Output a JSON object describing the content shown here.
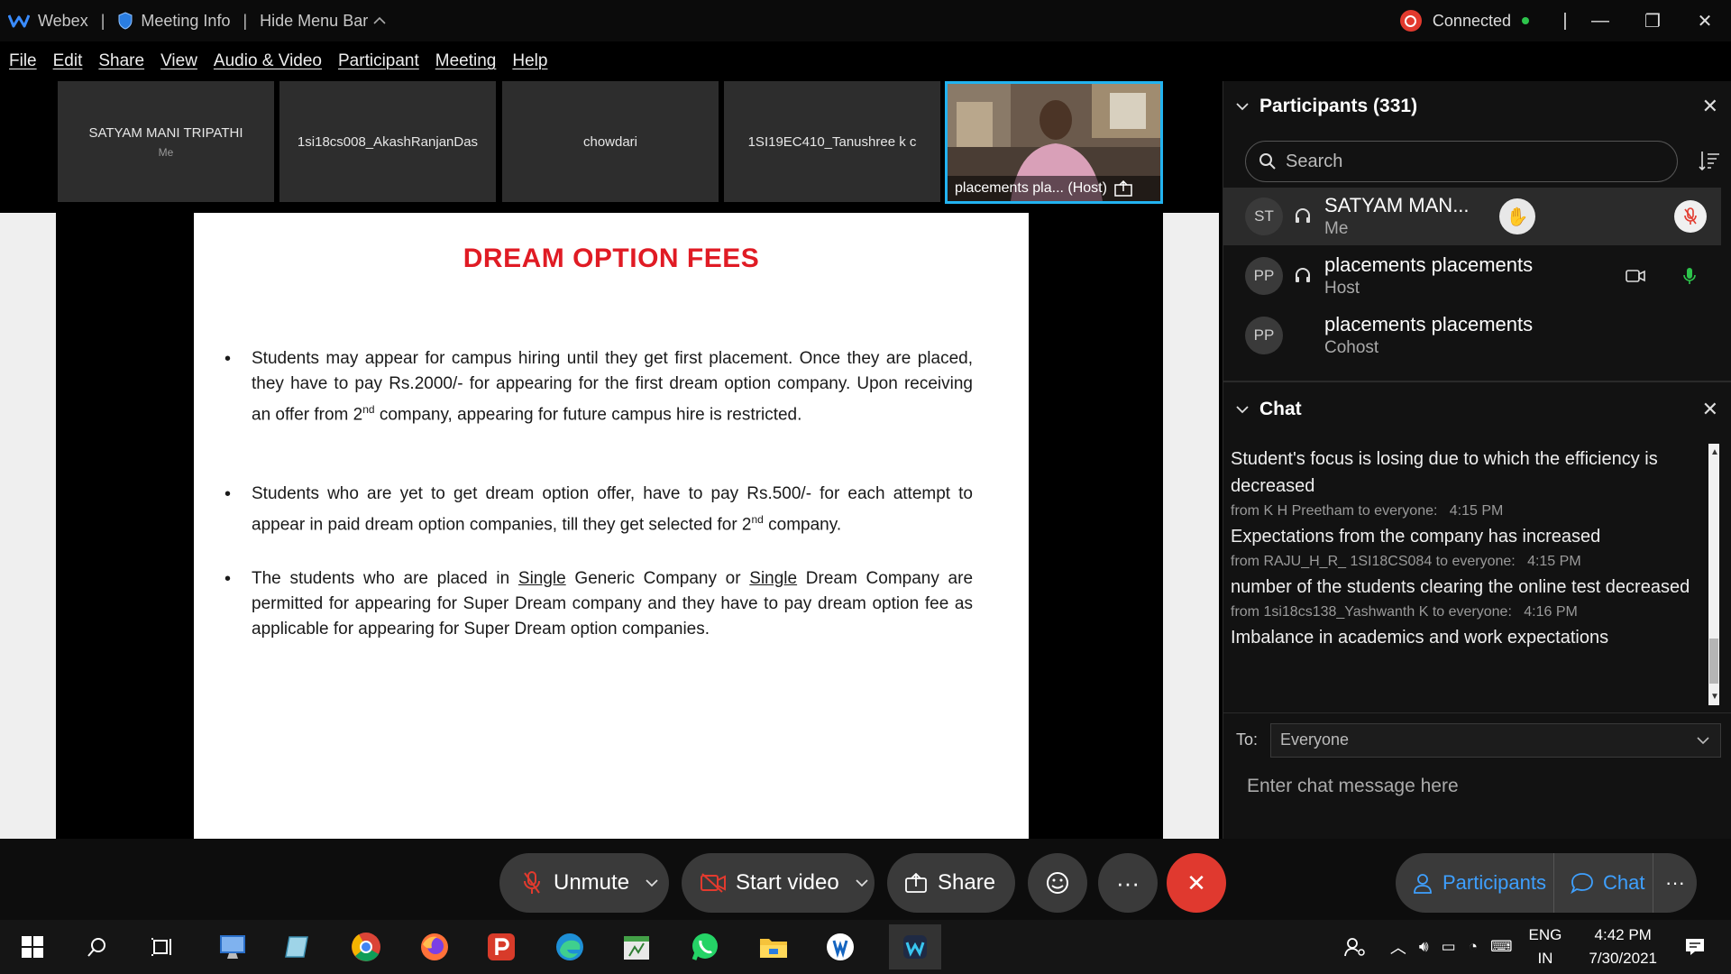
{
  "titlebar": {
    "app_name": "Webex",
    "meeting_info": "Meeting Info",
    "hide_menu": "Hide Menu Bar",
    "status": "Connected"
  },
  "menu": [
    "File",
    "Edit",
    "Share",
    "View",
    "Audio & Video",
    "Participant",
    "Meeting",
    "Help"
  ],
  "video_strip": {
    "tiles": [
      {
        "name": "SATYAM MANI TRIPATHI",
        "sub": "Me"
      },
      {
        "name": "1si18cs008_AkashRanjanDas",
        "sub": ""
      },
      {
        "name": "chowdari",
        "sub": ""
      },
      {
        "name": "1SI19EC410_Tanushree k c",
        "sub": ""
      }
    ],
    "host_tile": {
      "label": "placements pla... (Host)"
    }
  },
  "slide": {
    "title": "DREAM OPTION FEES",
    "bullet1_a": "Students may appear for campus hiring until they get first placement.  Once they are placed, they have to pay Rs.2000/- for appearing for the first dream option company. Upon receiving an offer from 2",
    "bullet1_sup": "nd",
    "bullet1_b": " company, appearing for future campus hire is restricted.",
    "bullet2_a": "Students who are yet to get dream option offer, have to pay Rs.500/- for each attempt to appear in paid dream option companies, till they get selected for 2",
    "bullet2_sup": "nd",
    "bullet2_b": " company.",
    "bullet3_a": "The students who are placed in ",
    "bullet3_u1": "Single",
    "bullet3_b": " Generic Company or ",
    "bullet3_u2": "Single",
    "bullet3_c": " Dream Company are permitted for appearing for Super Dream company and they have to pay dream option fee as applicable for appearing for Super Dream option companies."
  },
  "participants": {
    "header": "Participants (331)",
    "search_placeholder": "Search",
    "list": [
      {
        "initials": "ST",
        "name": "SATYAM MAN...",
        "role": "Me"
      },
      {
        "initials": "PP",
        "name": "placements placements",
        "role": "Host"
      },
      {
        "initials": "PP",
        "name": "placements placements",
        "role": "Cohost"
      }
    ]
  },
  "chat": {
    "header": "Chat",
    "messages": [
      {
        "text": "Student's focus is losing due to which the efficiency is decreased"
      },
      {
        "from": "from K H Preetham to everyone:",
        "time": "4:15 PM",
        "text": "Expectations from the company has increased"
      },
      {
        "from": "from RAJU_H_R_ 1SI18CS084 to everyone:",
        "time": "4:15 PM",
        "text": "number of the students clearing the online test decreased"
      },
      {
        "from": "from 1si18cs138_Yashwanth K to everyone:",
        "time": "4:16 PM",
        "text": "Imbalance in academics and work expectations"
      }
    ],
    "to_label": "To:",
    "to_value": "Everyone",
    "input_placeholder": "Enter chat message here"
  },
  "controls": {
    "unmute": "Unmute",
    "start_video": "Start video",
    "share": "Share",
    "participants": "Participants",
    "chat": "Chat"
  },
  "taskbar": {
    "lang1": "ENG",
    "lang2": "IN",
    "time": "4:42 PM",
    "date": "7/30/2021"
  }
}
